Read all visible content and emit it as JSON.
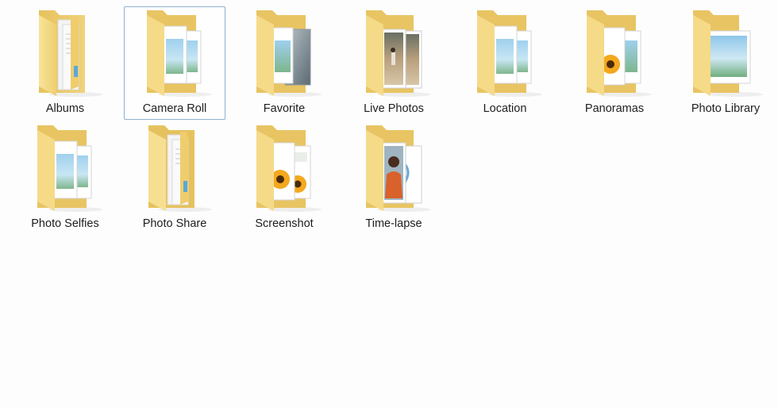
{
  "folders": [
    {
      "name": "Albums",
      "icon": "folder-documents-icon",
      "selected": false
    },
    {
      "name": "Camera Roll",
      "icon": "folder-photos-icon",
      "selected": true
    },
    {
      "name": "Favorite",
      "icon": "folder-photo-gray-icon",
      "selected": false
    },
    {
      "name": "Live Photos",
      "icon": "folder-beach-photo-icon",
      "selected": false
    },
    {
      "name": "Location",
      "icon": "folder-photos-icon",
      "selected": false
    },
    {
      "name": "Panoramas",
      "icon": "folder-flower-photo-icon",
      "selected": false
    },
    {
      "name": "Photo Library",
      "icon": "folder-landscape-icon",
      "selected": false
    },
    {
      "name": "Photo Selfies",
      "icon": "folder-photos-icon",
      "selected": false
    },
    {
      "name": "Photo Share",
      "icon": "folder-documents-icon",
      "selected": false
    },
    {
      "name": "Screenshot",
      "icon": "folder-flower-photo-icon",
      "selected": false
    },
    {
      "name": "Time-lapse",
      "icon": "folder-person-photo-icon",
      "selected": false
    }
  ],
  "colors": {
    "folder_back": "#e9c76a",
    "folder_front": "#f6dc8a",
    "selection_border": "#8fb0d2"
  }
}
